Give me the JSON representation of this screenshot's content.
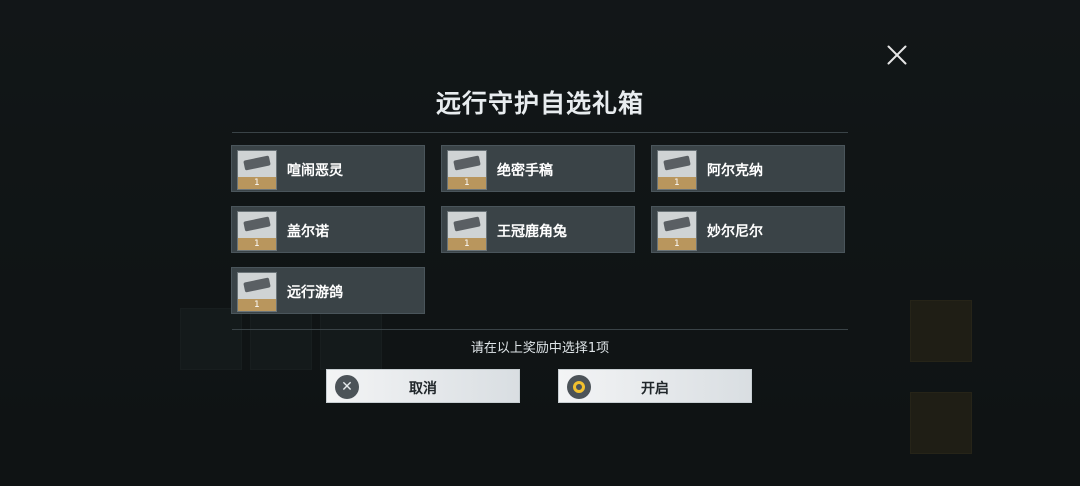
{
  "dialog": {
    "title": "远行守护自选礼箱",
    "hint": "请在以上奖励中选择1项",
    "cancel_label": "取消",
    "confirm_label": "开启",
    "close_icon": "close-icon"
  },
  "items": [
    {
      "name": "喧闹恶灵",
      "count": "1"
    },
    {
      "name": "绝密手稿",
      "count": "1"
    },
    {
      "name": "阿尔克纳",
      "count": "1"
    },
    {
      "name": "盖尔诺",
      "count": "1"
    },
    {
      "name": "王冠鹿角兔",
      "count": "1"
    },
    {
      "name": "妙尔尼尔",
      "count": "1"
    },
    {
      "name": "远行游鸽",
      "count": "1"
    }
  ],
  "colors": {
    "accent_gold": "#f2c12e",
    "item_bg": "#3a4347"
  }
}
